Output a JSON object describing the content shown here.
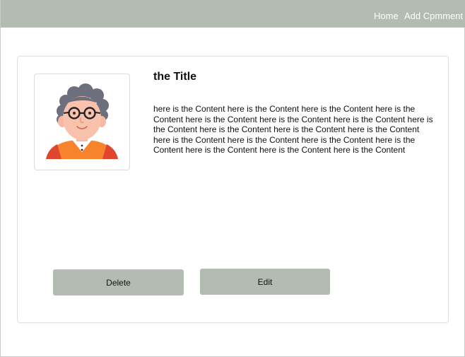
{
  "navbar": {
    "home_label": "Home",
    "add_comment_label": "Add Cpmment",
    "background_color": "#b3bcb0"
  },
  "card": {
    "avatar_icon": "elderly-man-avatar-icon",
    "title": "the Title",
    "content": "here is the Content here is the Content here is the Content here is the Content here is the Content here is the Content here is the Content here is the Content here is the Content here is the Content here is the Content here is the Content here is the Content here is the Content here is the Content here is the Content here is the Content here is the Content",
    "delete_label": "Delete",
    "edit_label": "Edit",
    "button_color": "#b3bcb0"
  }
}
